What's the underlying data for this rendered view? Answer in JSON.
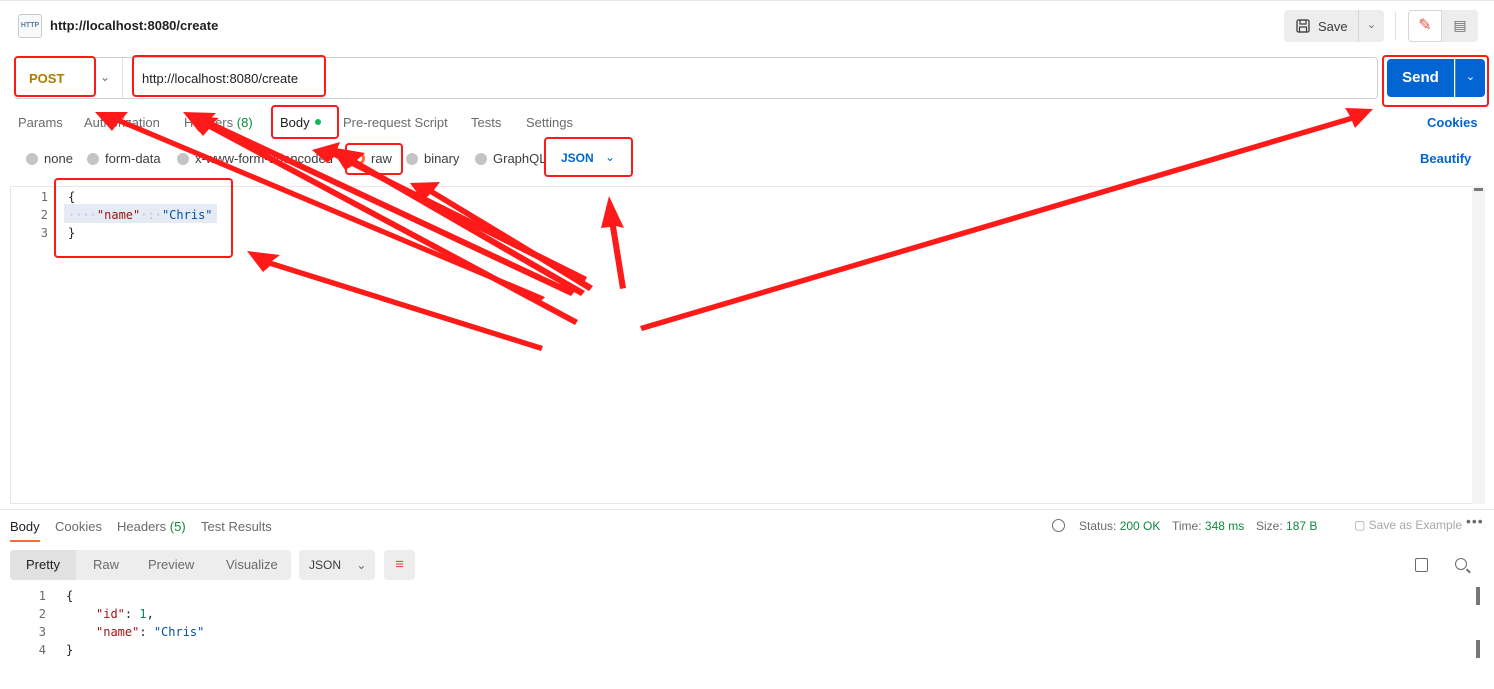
{
  "header": {
    "request_name": "http://localhost:8080/create",
    "http_icon_text": "HTTP",
    "save_label": "Save"
  },
  "request": {
    "method": "POST",
    "url": "http://localhost:8080/create",
    "send_label": "Send"
  },
  "tabs": {
    "params": "Params",
    "authorization": "Authorization",
    "headers": "Headers",
    "headers_count": "(8)",
    "body": "Body",
    "pre_request": "Pre-request Script",
    "tests": "Tests",
    "settings": "Settings",
    "cookies": "Cookies"
  },
  "body_types": {
    "none": "none",
    "form_data": "form-data",
    "urlencoded": "x-www-form-urlencoded",
    "raw": "raw",
    "binary": "binary",
    "graphql": "GraphQL",
    "format": "JSON",
    "beautify": "Beautify",
    "selected": "raw"
  },
  "editor": {
    "lines": [
      "1",
      "2",
      "3"
    ],
    "open_brace": "{",
    "indent": "····",
    "key": "\"name\"",
    "sep": "·:·",
    "value": "\"Chris\"",
    "close_brace": "}"
  },
  "response": {
    "tabs": {
      "body": "Body",
      "cookies": "Cookies",
      "headers": "Headers",
      "headers_count": "(5)",
      "test_results": "Test Results"
    },
    "status_label": "Status:",
    "status_value": "200 OK",
    "time_label": "Time:",
    "time_value": "348 ms",
    "size_label": "Size:",
    "size_value": "187 B",
    "save_example": "Save as Example",
    "more": "•••",
    "views": {
      "pretty": "Pretty",
      "raw": "Raw",
      "preview": "Preview",
      "visualize": "Visualize"
    },
    "format": "JSON",
    "lines": [
      "1",
      "2",
      "3",
      "4"
    ],
    "open_brace": "{",
    "id_key": "\"id\"",
    "id_value": "1",
    "name_key": "\"name\"",
    "name_value": "\"Chris\"",
    "close_brace": "}"
  },
  "icons": [
    "http-icon",
    "save-icon",
    "chevron-down-icon",
    "pencil-icon",
    "comment-icon",
    "globe-icon",
    "wrap-lines-icon",
    "copy-icon",
    "search-icon"
  ],
  "colors": {
    "annotation": "#ff1a1a",
    "send": "#0265d2",
    "method": "#ad7a03",
    "accent": "#ff6c37",
    "ok": "#0f8a3c"
  }
}
